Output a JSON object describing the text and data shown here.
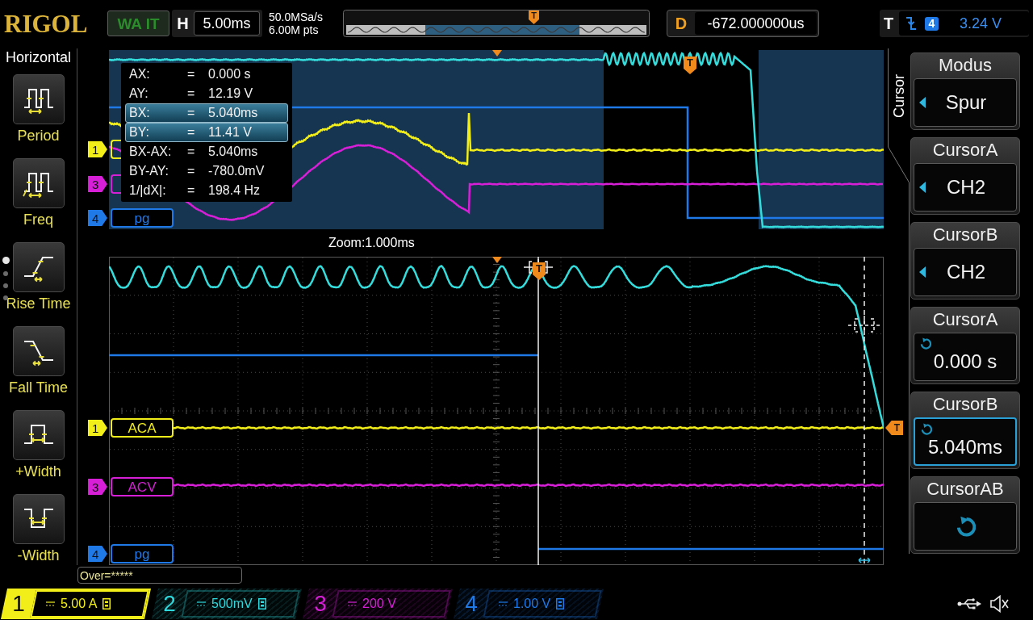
{
  "header": {
    "logo": "RIGOL",
    "run_status": "WA IT",
    "timebase": {
      "label": "H",
      "value": "5.00ms"
    },
    "sample_rate": "50.0MSa/s",
    "memory_depth": "6.00M pts",
    "memory_trigger_marker": "T",
    "delay": {
      "label": "D",
      "value": "-672.000000us"
    },
    "trigger": {
      "label": "T",
      "source": "4",
      "value": "3.24 V"
    }
  },
  "side_menu": {
    "title": "Horizontal",
    "items": [
      {
        "kind": "period",
        "label": "Period"
      },
      {
        "kind": "freq",
        "label": "Freq"
      },
      {
        "kind": "rise",
        "label": "Rise Time"
      },
      {
        "kind": "fall",
        "label": "Fall Time"
      },
      {
        "kind": "pos_width",
        "label": "+Width"
      },
      {
        "kind": "neg_width",
        "label": "-Width"
      }
    ],
    "pages": [
      {
        "selected": true
      },
      {
        "selected": false
      },
      {
        "selected": false
      },
      {
        "selected": false
      }
    ]
  },
  "overview": {
    "trigger_marker": "T",
    "channel_markers": [
      {
        "number": "1",
        "color": "#f2ee1a"
      },
      {
        "number": "3",
        "color": "#d61fd6"
      },
      {
        "number": "4",
        "color": "#1f7ae8",
        "label": "pg"
      }
    ],
    "cursor_readout": [
      {
        "label": "AX:",
        "separator": "=",
        "value": "0.000 s",
        "selected": false
      },
      {
        "label": "AY:",
        "separator": "=",
        "value": "12.19 V",
        "selected": false
      },
      {
        "label": "BX:",
        "separator": "=",
        "value": "5.040ms",
        "selected": true
      },
      {
        "label": "BY:",
        "separator": "=",
        "value": "11.41 V",
        "selected": true
      },
      {
        "label": "BX-AX:",
        "separator": "=",
        "value": "5.040ms",
        "selected": false
      },
      {
        "label": "BY-AY:",
        "separator": "=",
        "value": "-780.0mV",
        "selected": false
      },
      {
        "label": "1/|dX|:",
        "separator": "=",
        "value": "198.4 Hz",
        "selected": false
      }
    ]
  },
  "zoom_label": "Zoom:1.000ms",
  "main_view": {
    "trigger_marker": "T",
    "trigger_level_marker": "T",
    "channel_markers": [
      {
        "number": "1",
        "label": "ACA",
        "color": "#f2ee1a"
      },
      {
        "number": "3",
        "label": "ACV",
        "color": "#d61fd6"
      },
      {
        "number": "4",
        "label": "pg",
        "color": "#1f7ae8"
      }
    ]
  },
  "status_text": "Over=*****",
  "cursor_menu": {
    "tab": "Cursor",
    "items": [
      {
        "kind": "option",
        "title": "Modus",
        "value": "Spur",
        "selected": false
      },
      {
        "kind": "option",
        "title": "CursorA",
        "value": "CH2",
        "selected": false
      },
      {
        "kind": "option",
        "title": "CursorB",
        "value": "CH2",
        "selected": false
      },
      {
        "kind": "knob",
        "title": "CursorA",
        "value": "0.000 s",
        "selected": false
      },
      {
        "kind": "knob",
        "title": "CursorB",
        "value": "5.040ms",
        "selected": true
      },
      {
        "kind": "action",
        "title": "CursorAB",
        "selected": false
      }
    ]
  },
  "channels": [
    {
      "number": "1",
      "scale": "5.00 A",
      "color": "#f2ee1a",
      "selected": true,
      "bw_limit": true
    },
    {
      "number": "2",
      "scale": "500mV",
      "color": "#2fd8dc",
      "selected": false,
      "bw_limit": true
    },
    {
      "number": "3",
      "scale": "200 V",
      "color": "#d61fd6",
      "selected": false,
      "bw_limit": false
    },
    {
      "number": "4",
      "scale": "1.00 V",
      "color": "#1f7ae8",
      "selected": false,
      "bw_limit": true
    }
  ]
}
